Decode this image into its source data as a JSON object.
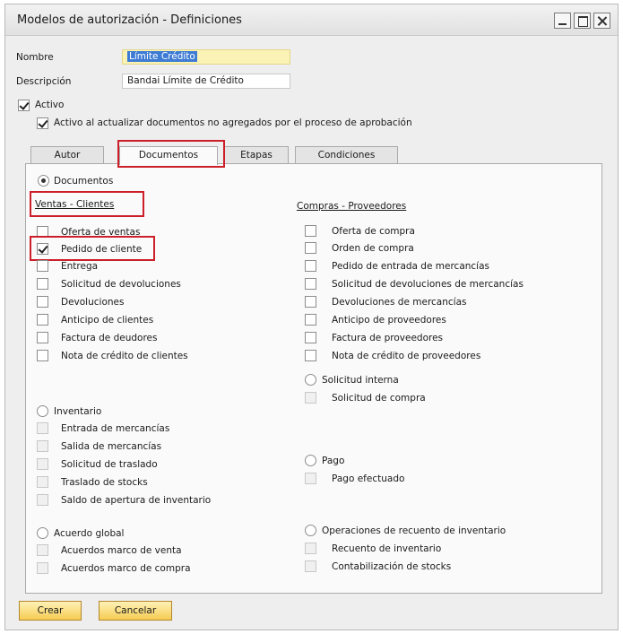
{
  "window": {
    "title": "Modelos de autorización - Definiciones"
  },
  "form": {
    "nombre_label": "Nombre",
    "nombre_value": "Límite Crédito",
    "descripcion_label": "Descripción",
    "descripcion_value": "Bandai Límite de Crédito",
    "activo_label": "Activo",
    "activo_checked": true,
    "activo_docs_label": "Activo al actualizar documentos no agregados por el proceso de aprobación",
    "activo_docs_checked": true
  },
  "tabs": [
    {
      "label": "Autor",
      "active": false
    },
    {
      "label": "Documentos",
      "active": true
    },
    {
      "label": "Etapas",
      "active": false
    },
    {
      "label": "Condiciones",
      "active": false
    }
  ],
  "documentos_radio_label": "Documentos",
  "ventas": {
    "heading": "Ventas - Clientes",
    "items": [
      {
        "label": "Oferta de ventas",
        "checked": false
      },
      {
        "label": "Pedido de cliente",
        "checked": true
      },
      {
        "label": "Entrega",
        "checked": false
      },
      {
        "label": "Solicitud de devoluciones",
        "checked": false
      },
      {
        "label": "Devoluciones",
        "checked": false
      },
      {
        "label": "Anticipo de clientes",
        "checked": false
      },
      {
        "label": "Factura de deudores",
        "checked": false
      },
      {
        "label": "Nota de crédito de clientes",
        "checked": false
      }
    ]
  },
  "compras": {
    "heading": "Compras - Proveedores",
    "items": [
      {
        "label": "Oferta de compra",
        "checked": false
      },
      {
        "label": "Orden de compra",
        "checked": false
      },
      {
        "label": "Pedido de entrada de mercancías",
        "checked": false
      },
      {
        "label": "Solicitud de devoluciones de mercancías",
        "checked": false
      },
      {
        "label": "Devoluciones de mercancías",
        "checked": false
      },
      {
        "label": "Anticipo de proveedores",
        "checked": false
      },
      {
        "label": "Factura de proveedores",
        "checked": false
      },
      {
        "label": "Nota de crédito de proveedores",
        "checked": false
      }
    ]
  },
  "solicitud_interna": {
    "label": "Solicitud interna",
    "items": [
      {
        "label": "Solicitud de compra"
      }
    ]
  },
  "inventario": {
    "label": "Inventario",
    "items": [
      {
        "label": "Entrada de mercancías"
      },
      {
        "label": "Salida de mercancías"
      },
      {
        "label": "Solicitud de traslado"
      },
      {
        "label": "Traslado de stocks"
      },
      {
        "label": "Saldo de apertura de inventario"
      }
    ]
  },
  "pago": {
    "label": "Pago",
    "items": [
      {
        "label": "Pago efectuado"
      }
    ]
  },
  "acuerdo_global": {
    "label": "Acuerdo global",
    "items": [
      {
        "label": "Acuerdos marco de venta"
      },
      {
        "label": "Acuerdos marco de compra"
      }
    ]
  },
  "recuento": {
    "label": "Operaciones de recuento de inventario",
    "items": [
      {
        "label": "Recuento de inventario"
      },
      {
        "label": "Contabilización de stocks"
      }
    ]
  },
  "buttons": {
    "crear": "Crear",
    "cancelar": "Cancelar"
  },
  "colors": {
    "highlight_box": "#cc1f2a",
    "button_yellow": "#f5cc52",
    "field_yellow": "#fbf3b5"
  }
}
